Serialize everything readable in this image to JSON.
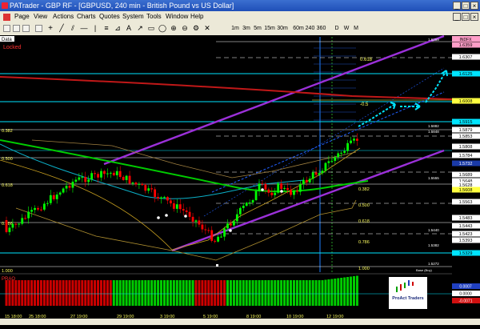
{
  "window": {
    "title": "PATrader - GBP RF - [GBPUSD, 240 min - British Pound vs US Dollar]"
  },
  "menu": {
    "items": [
      "Page",
      "View",
      "Actions",
      "Charts",
      "Quotes",
      "System",
      "Tools",
      "Window",
      "Help"
    ]
  },
  "toolbar": {
    "timeframes": [
      "1m",
      "3m",
      "5m",
      "15m",
      "30m",
      "60m",
      "240",
      "360",
      "D",
      "W",
      "M"
    ]
  },
  "chart": {
    "data_label": "Data",
    "locked_label": "Locked",
    "symbol_tag": "INDFX",
    "fib_labels": [
      "0.382",
      "0.500",
      "0.618",
      "0.786",
      "1.000"
    ],
    "mid_fib_labels": [
      "0.382",
      "0.500",
      "0.618",
      "0.786",
      "1.000"
    ],
    "top_labels": [
      "0.618",
      "-0.5"
    ],
    "base_label": "Base (Buy)",
    "logo_text": "ProAct Traders",
    "price_tags": [
      {
        "v": "1.6359",
        "bg": "#ff9ec8"
      },
      {
        "v": "1.6307",
        "bg": "#ffffff"
      },
      {
        "v": "1.6125",
        "bg": "#00e5ff"
      },
      {
        "v": "1.6008",
        "bg": "#ffff40"
      },
      {
        "v": "1.5915",
        "bg": "#00e5ff"
      },
      {
        "v": "1.5879",
        "bg": "#ffffff"
      },
      {
        "v": "1.5853",
        "bg": "#ffffff"
      },
      {
        "v": "1.5808",
        "bg": "#ffffff"
      },
      {
        "v": "1.5784",
        "bg": "#ffffff"
      },
      {
        "v": "1.5732",
        "bg": "#1a3aa8"
      },
      {
        "v": "1.5689",
        "bg": "#ffffff"
      },
      {
        "v": "1.5648",
        "bg": "#ffffff"
      },
      {
        "v": "1.5628",
        "bg": "#ffffff"
      },
      {
        "v": "1.5608",
        "bg": "#ffff40"
      },
      {
        "v": "1.5563",
        "bg": "#ffffff"
      },
      {
        "v": "1.5483",
        "bg": "#ffffff"
      },
      {
        "v": "1.5443",
        "bg": "#ffffff"
      },
      {
        "v": "1.5423",
        "bg": "#ffffff"
      },
      {
        "v": "1.5393",
        "bg": "#ffffff"
      },
      {
        "v": "1.5329",
        "bg": "#00e5ff"
      }
    ],
    "mid_price_labels": [
      "1.5882",
      "1.5848",
      "1.5555",
      "1.5440",
      "1.5382",
      "1.5272",
      "1.6259"
    ],
    "date_labels": [
      "15 18:00",
      "25 18:00",
      "27 19:00",
      "29 19:00",
      "3 19:00",
      "5 19:00",
      "8 19:00",
      "10 19:00",
      "12 19:00"
    ],
    "indicator_label": "PRAO",
    "indicator_tags": [
      "0.0007",
      "0.0000",
      "-0.0071"
    ]
  },
  "colors": {
    "channel": "#9b30d9",
    "cyan": "#00e5ff",
    "bull": "#00ff00",
    "bear": "#ff0000",
    "ma_green": "#00cc00",
    "ma_red": "#cc0000"
  }
}
